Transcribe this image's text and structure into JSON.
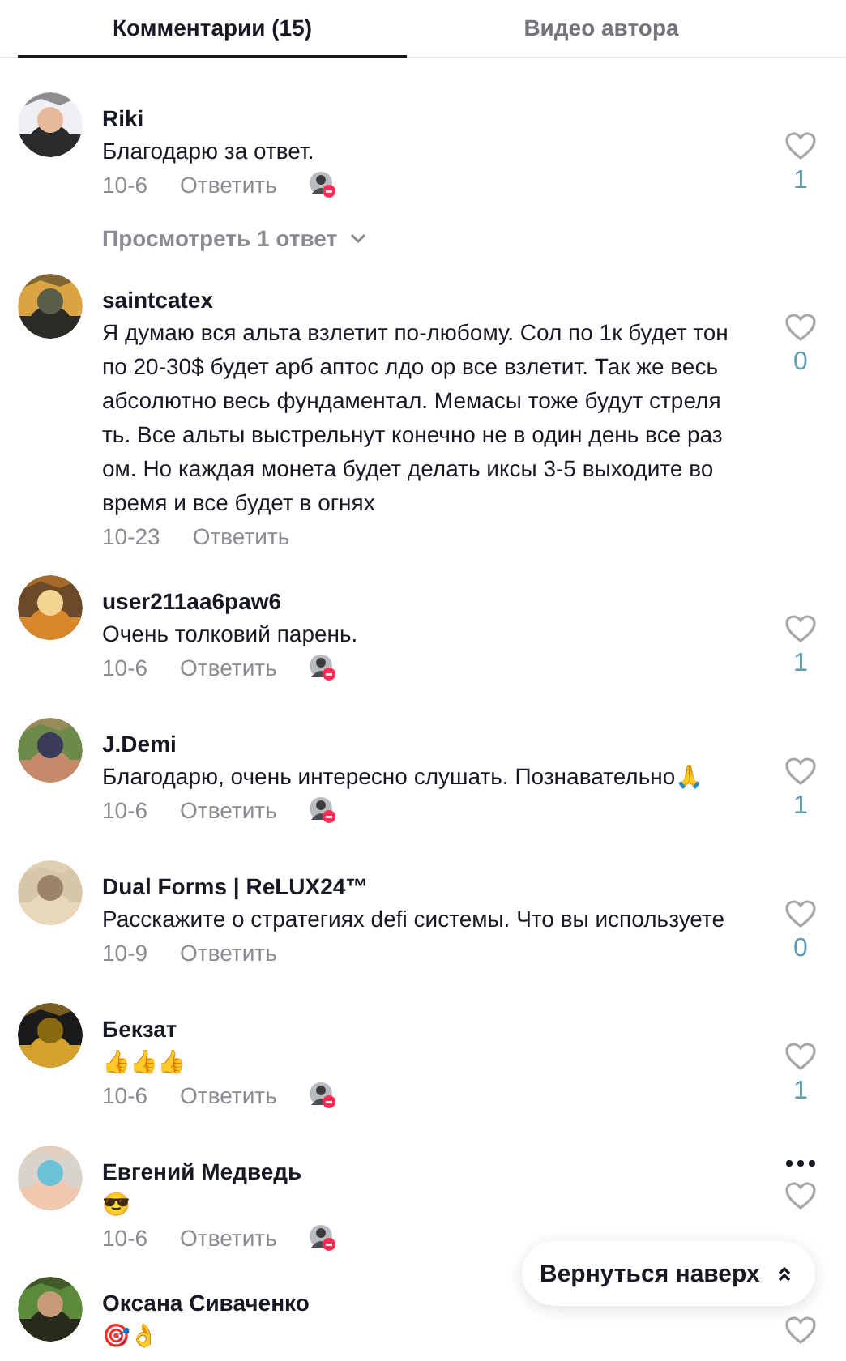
{
  "tabs": [
    {
      "label": "Комментарии (15)",
      "selected": true
    },
    {
      "label": "Видео автора",
      "selected": false
    }
  ],
  "comments": [
    {
      "name": "Riki",
      "text": "Благодарю за ответ.",
      "date": "10-6",
      "reply": "Ответить",
      "author_liked": true,
      "likes": "1",
      "menu_visible": false,
      "replies": "Просмотреть 1 ответ"
    },
    {
      "name": "saintcatex",
      "text": "Я думаю вся альта взлетит по-любому. Сол по 1к будет тон по 20-30$ будет арб аптос лдо ор все взлетит. Так же весь абсолютно весь фундаментал. Мемасы тоже будут стрелять. Все альты выстрельнут конечно не в один день все разом. Но каждая монета будет делать иксы 3-5 выходите во время и все будет в огнях",
      "date": "10-23",
      "reply": "Ответить",
      "author_liked": false,
      "likes": "0",
      "menu_visible": false
    },
    {
      "name": "user211aa6paw6",
      "text": "Очень толковий парень.",
      "date": "10-6",
      "reply": "Ответить",
      "author_liked": true,
      "likes": "1",
      "menu_visible": false
    },
    {
      "name": "J.Demi",
      "text": "Благодарю, очень интересно слушать. Познавательно🙏",
      "date": "10-6",
      "reply": "Ответить",
      "author_liked": true,
      "likes": "1",
      "menu_visible": false
    },
    {
      "name": "Dual Forms | ReLUX24™",
      "text": "Расскажите о стратегиях defi системы. Что вы используете",
      "date": "10-9",
      "reply": "Ответить",
      "author_liked": false,
      "likes": "0",
      "menu_visible": false
    },
    {
      "name": "Бекзат",
      "text": "👍👍👍",
      "date": "10-6",
      "reply": "Ответить",
      "author_liked": true,
      "likes": "1",
      "menu_visible": false
    },
    {
      "name": "Евгений Медведь",
      "text": "😎",
      "date": "10-6",
      "reply": "Ответить",
      "author_liked": true,
      "menu_visible": true
    },
    {
      "name": "Оксана Сиваченко",
      "text": "🎯👌",
      "menu_visible": false
    }
  ],
  "back_to_top": {
    "label": "Вернуться наверх"
  }
}
